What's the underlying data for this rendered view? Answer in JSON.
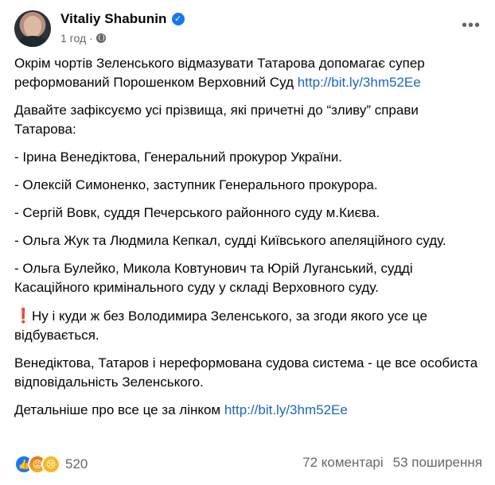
{
  "author": {
    "name": "Vitaliy Shabunin",
    "verified_icon": "verified-badge-icon"
  },
  "meta": {
    "time": "1 год",
    "separator": "·",
    "audience_icon": "globe-icon"
  },
  "menu": {
    "more_label": "•••"
  },
  "post": {
    "p1_text": "Окрім чортів Зеленського відмазувати Татарова допомагає супер реформований Порошенком Верховний Суд ",
    "p1_link": "http://bit.ly/3hm52Ee",
    "p2": "Давайте зафіксуємо усі прізвища, які причетні до “зливу” справи Татарова:",
    "p3": "- Ірина Венедіктова, Генеральний прокурор України.",
    "p4": "- Олексій Симоненко, заступник Генерального прокурора.",
    "p5": "- Сергій Вовк, суддя Печерського районного суду м.Києва.",
    "p6": "- Ольга Жук та Людмила Кепкал, судді Київського апеляційного суду.",
    "p7": "- Ольга Булейко, Микола Ковтунович та Юрій Луганський, судді Касаційного кримінального суду у складі Верховного суду.",
    "p8_emoji": "❗",
    "p8_text": "Ну і куди ж без Володимира Зеленського, за згоди якого усе це відбувається.",
    "p9": "Венедіктова, Татаров і нереформована судова система - це все особиста відповідальність Зеленського.",
    "p10_text": "Детальніше про все це за лінком ",
    "p10_link": "http://bit.ly/3hm52Ee"
  },
  "footer": {
    "reactions": [
      "like-reaction-icon",
      "angry-reaction-icon",
      "sad-reaction-icon"
    ],
    "reaction_count": "520",
    "comments": "72 коментарі",
    "shares": "53 поширення"
  },
  "colors": {
    "link": "#1a66c2",
    "verified": "#1877f2",
    "secondary_text": "#65676b"
  }
}
